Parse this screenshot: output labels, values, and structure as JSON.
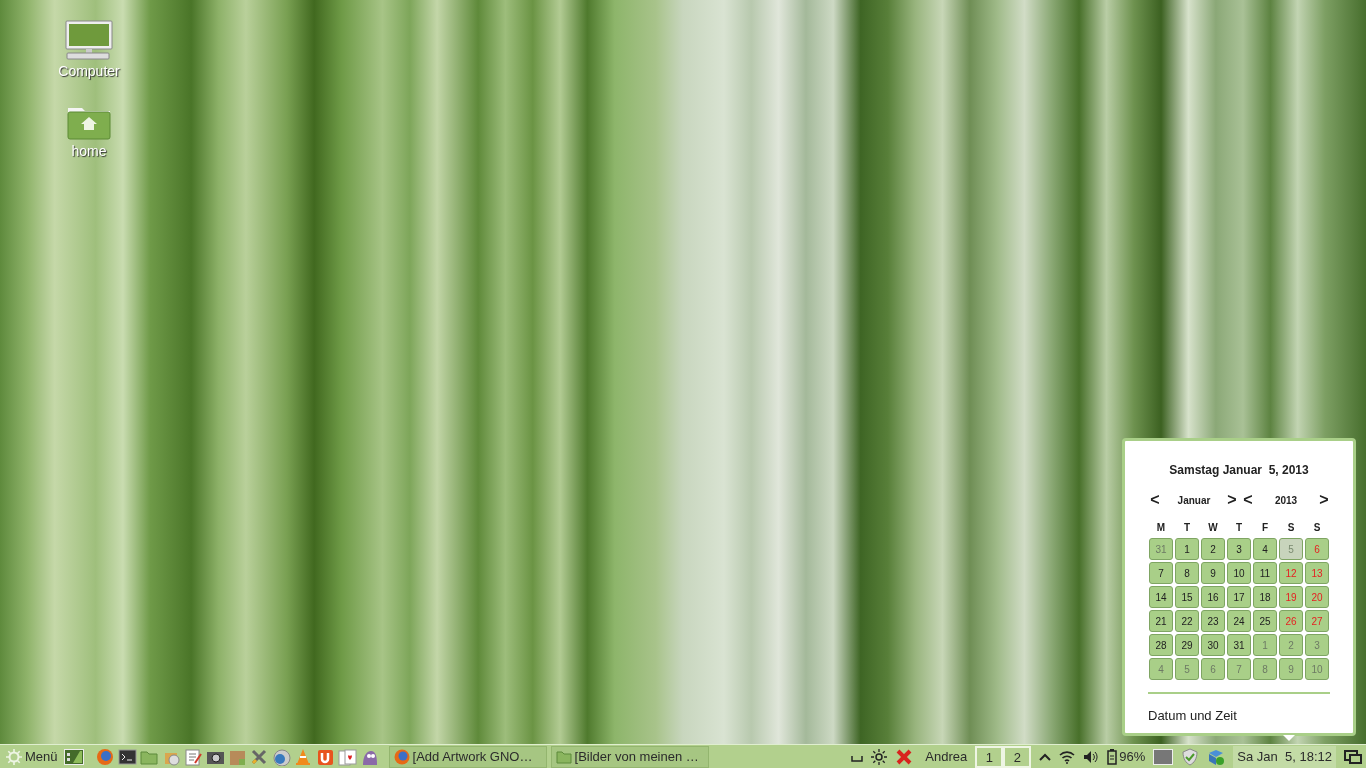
{
  "desktop_icons": [
    {
      "kind": "computer",
      "label": "Computer"
    },
    {
      "kind": "home",
      "label": "home"
    }
  ],
  "calendar": {
    "heading": "Samstag Januar  5, 2013",
    "prev_month": "<",
    "month": "Januar",
    "next_month": ">",
    "prev_year": "<",
    "year": "2013",
    "next_year": ">",
    "weekdays": [
      "M",
      "T",
      "W",
      "T",
      "F",
      "S",
      "S"
    ],
    "days": [
      {
        "label": "31",
        "kind": "other",
        "selected": false
      },
      {
        "label": "1",
        "kind": "weekday",
        "selected": false
      },
      {
        "label": "2",
        "kind": "weekday",
        "selected": false
      },
      {
        "label": "3",
        "kind": "weekday",
        "selected": false
      },
      {
        "label": "4",
        "kind": "weekday",
        "selected": false
      },
      {
        "label": "5",
        "kind": "weekend",
        "selected": true
      },
      {
        "label": "6",
        "kind": "weekend",
        "selected": false
      },
      {
        "label": "7",
        "kind": "weekday",
        "selected": false
      },
      {
        "label": "8",
        "kind": "weekday",
        "selected": false
      },
      {
        "label": "9",
        "kind": "weekday",
        "selected": false
      },
      {
        "label": "10",
        "kind": "weekday",
        "selected": false
      },
      {
        "label": "11",
        "kind": "weekday",
        "selected": false
      },
      {
        "label": "12",
        "kind": "weekend",
        "selected": false
      },
      {
        "label": "13",
        "kind": "weekend",
        "selected": false
      },
      {
        "label": "14",
        "kind": "weekday",
        "selected": false
      },
      {
        "label": "15",
        "kind": "weekday",
        "selected": false
      },
      {
        "label": "16",
        "kind": "weekday",
        "selected": false
      },
      {
        "label": "17",
        "kind": "weekday",
        "selected": false
      },
      {
        "label": "18",
        "kind": "weekday",
        "selected": false
      },
      {
        "label": "19",
        "kind": "weekend",
        "selected": false
      },
      {
        "label": "20",
        "kind": "weekend",
        "selected": false
      },
      {
        "label": "21",
        "kind": "weekday",
        "selected": false
      },
      {
        "label": "22",
        "kind": "weekday",
        "selected": false
      },
      {
        "label": "23",
        "kind": "weekday",
        "selected": false
      },
      {
        "label": "24",
        "kind": "weekday",
        "selected": false
      },
      {
        "label": "25",
        "kind": "weekday",
        "selected": false
      },
      {
        "label": "26",
        "kind": "weekend",
        "selected": false
      },
      {
        "label": "27",
        "kind": "weekend",
        "selected": false
      },
      {
        "label": "28",
        "kind": "weekday",
        "selected": false
      },
      {
        "label": "29",
        "kind": "weekday",
        "selected": false
      },
      {
        "label": "30",
        "kind": "weekday",
        "selected": false
      },
      {
        "label": "31",
        "kind": "weekday",
        "selected": false
      },
      {
        "label": "1",
        "kind": "other",
        "selected": false
      },
      {
        "label": "2",
        "kind": "other",
        "selected": false
      },
      {
        "label": "3",
        "kind": "other",
        "selected": false
      },
      {
        "label": "4",
        "kind": "other",
        "selected": false
      },
      {
        "label": "5",
        "kind": "other",
        "selected": false
      },
      {
        "label": "6",
        "kind": "other",
        "selected": false
      },
      {
        "label": "7",
        "kind": "other",
        "selected": false
      },
      {
        "label": "8",
        "kind": "other",
        "selected": false
      },
      {
        "label": "9",
        "kind": "other",
        "selected": false
      },
      {
        "label": "10",
        "kind": "other",
        "selected": false
      }
    ],
    "footer_link": "Datum und Zeit"
  },
  "taskbar": {
    "menu_label": "Menü",
    "windows": [
      {
        "kind": "browser",
        "title": "[Add  Artwork GNO…"
      },
      {
        "kind": "folder",
        "title": "[Bilder von meinen …"
      }
    ],
    "user": "Andrea",
    "workspaces": [
      "1",
      "2"
    ],
    "battery": "96%",
    "clock": "Sa Jan  5, 18:12"
  }
}
